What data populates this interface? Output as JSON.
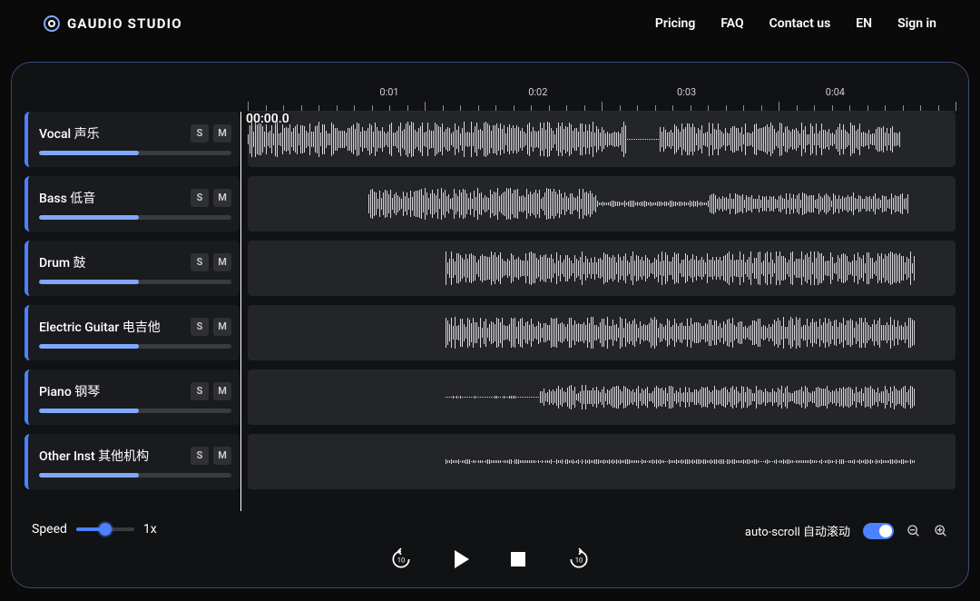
{
  "brand": "GAUDIO STUDIO",
  "nav": {
    "pricing": "Pricing",
    "faq": "FAQ",
    "contact": "Contact us",
    "lang": "EN",
    "signin": "Sign in"
  },
  "timeline": {
    "timestamp": "00:00.0",
    "labels": [
      "0:01",
      "0:02",
      "0:03",
      "0:04"
    ]
  },
  "tracks": [
    {
      "name": "Vocal 声乐",
      "s": "S",
      "m": "M",
      "vol": 52,
      "wave_start": 0,
      "segments": [
        [
          0,
          58,
          0.9
        ],
        [
          58,
          63,
          0.02
        ],
        [
          63,
          100,
          0.85
        ]
      ]
    },
    {
      "name": "Bass 低音",
      "s": "S",
      "m": "M",
      "vol": 52,
      "wave_start": 17,
      "segments": [
        [
          0,
          42,
          0.8
        ],
        [
          42,
          63,
          0.15
        ],
        [
          63,
          100,
          0.55
        ]
      ]
    },
    {
      "name": "Drum 鼓",
      "s": "S",
      "m": "M",
      "vol": 52,
      "wave_start": 28,
      "segments": [
        [
          0,
          100,
          0.85
        ]
      ]
    },
    {
      "name": "Electric Guitar 电吉他",
      "s": "S",
      "m": "M",
      "vol": 52,
      "wave_start": 28,
      "segments": [
        [
          0,
          100,
          0.8
        ]
      ]
    },
    {
      "name": "Piano 钢琴",
      "s": "S",
      "m": "M",
      "vol": 52,
      "wave_start": 28,
      "segments": [
        [
          0,
          20,
          0.05
        ],
        [
          20,
          100,
          0.6
        ]
      ]
    },
    {
      "name": "Other Inst 其他机构",
      "s": "S",
      "m": "M",
      "vol": 52,
      "wave_start": 28,
      "segments": [
        [
          0,
          100,
          0.12
        ]
      ]
    }
  ],
  "controls": {
    "speed_label": "Speed",
    "speed_value": "1x",
    "autoscroll_label": "auto-scroll 自动滚动",
    "skip_back": "10",
    "skip_fwd": "10"
  }
}
